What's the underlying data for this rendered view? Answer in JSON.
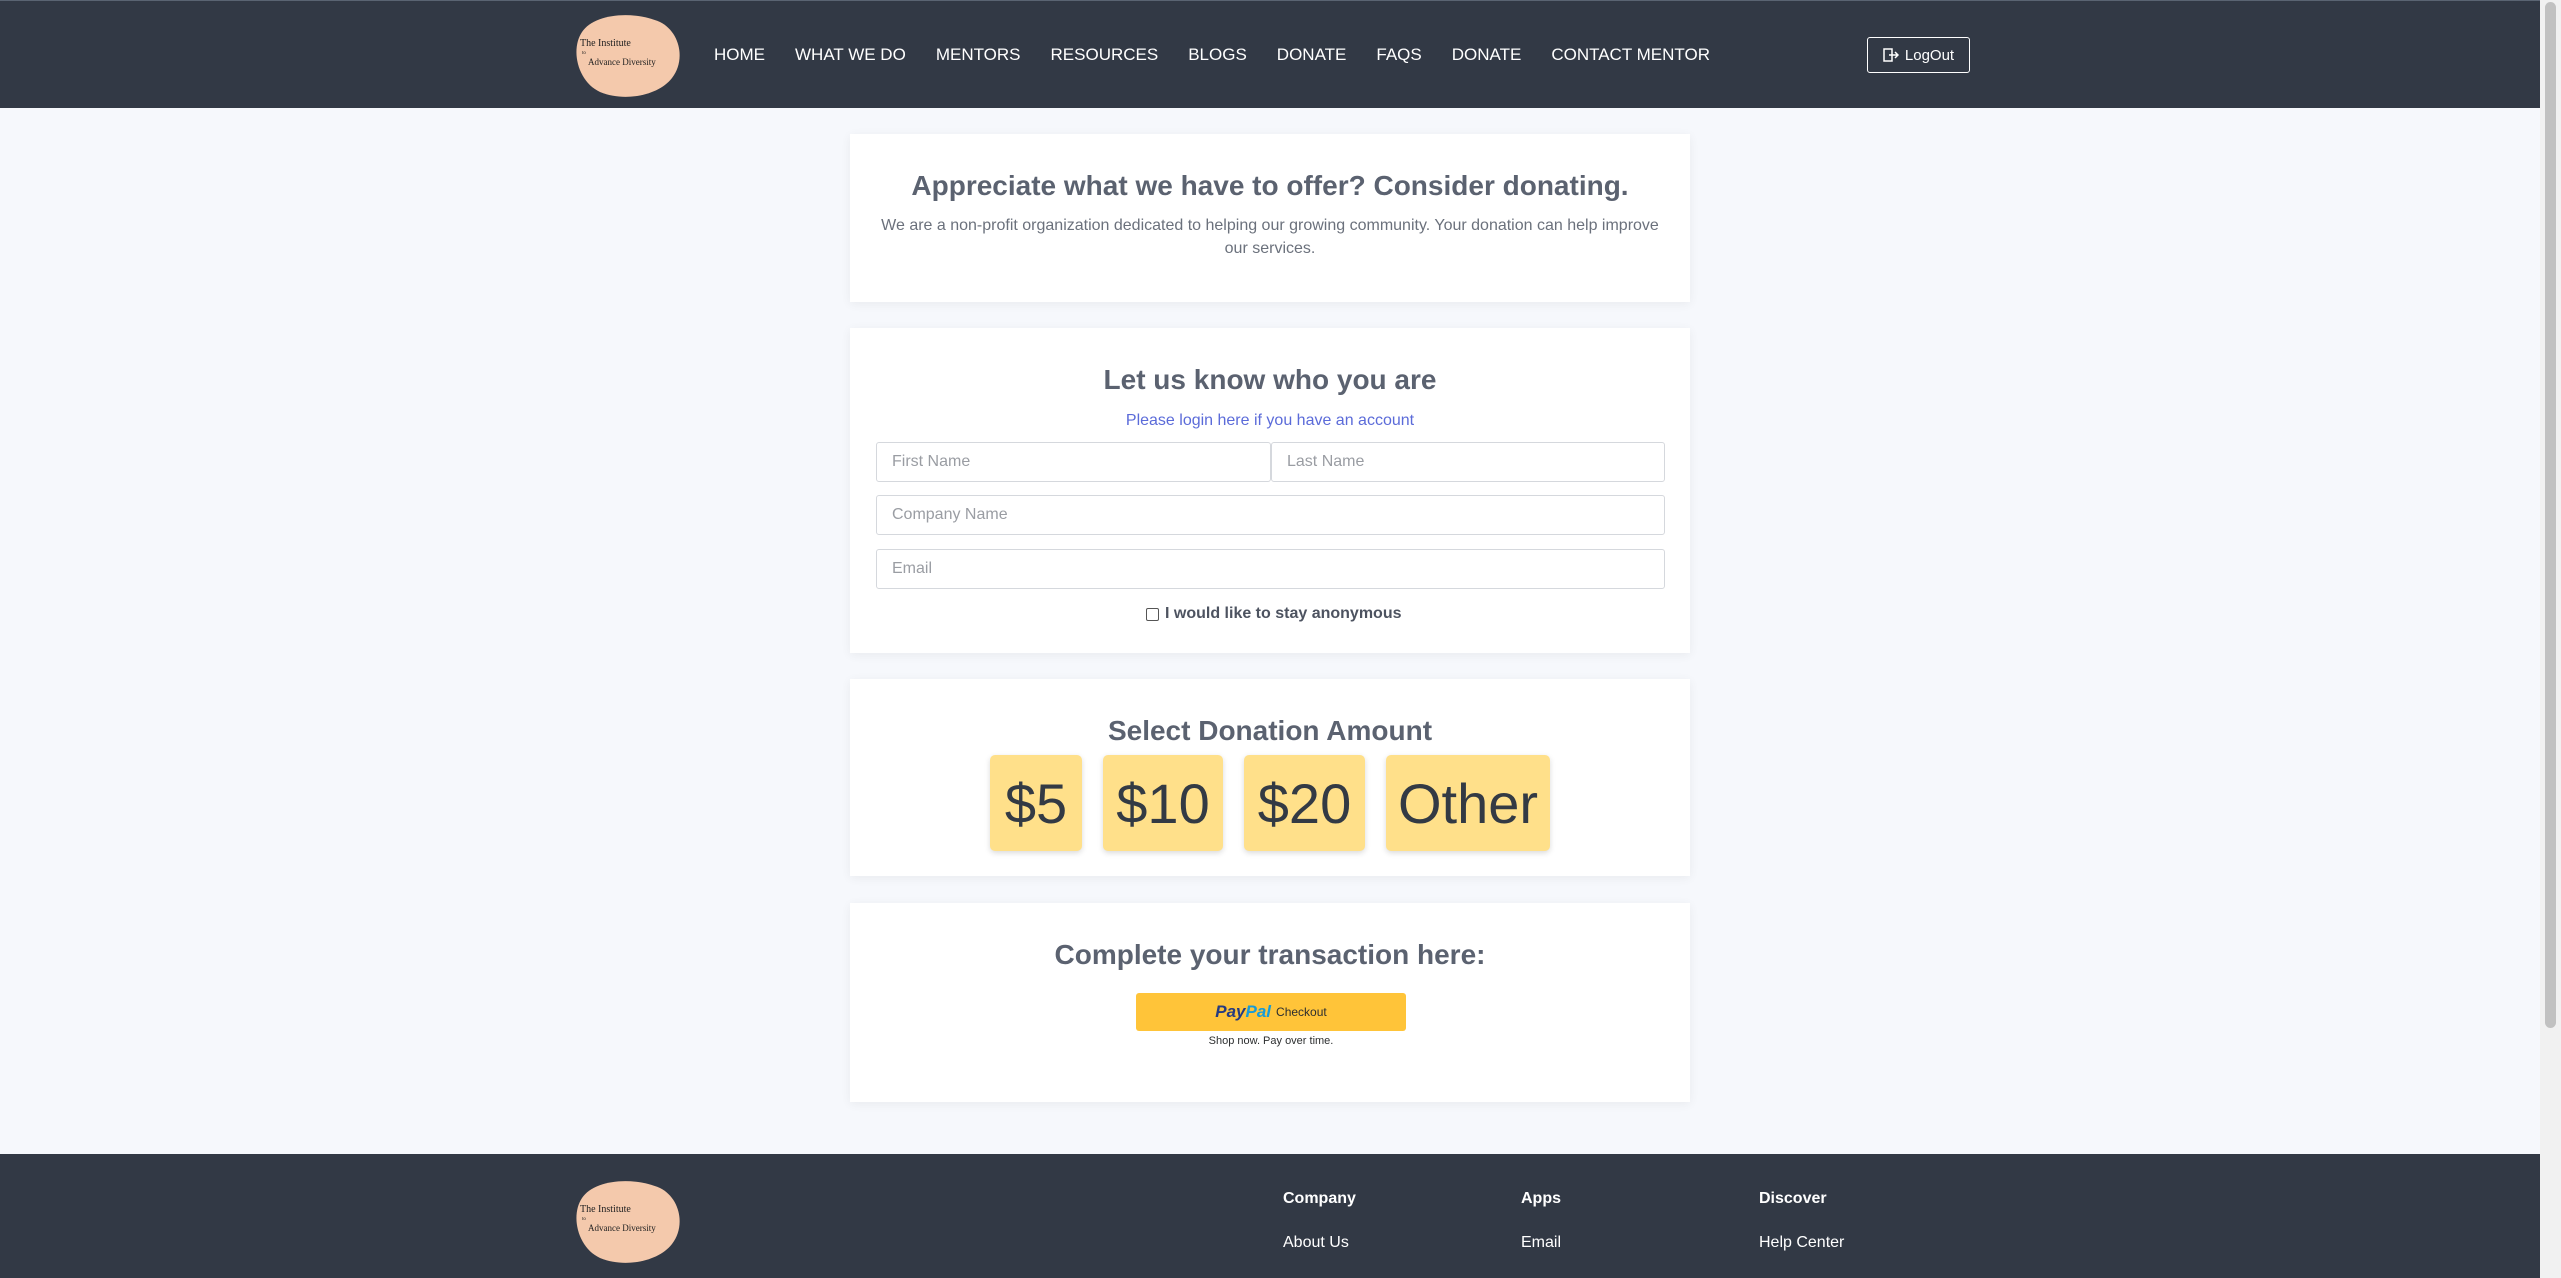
{
  "header": {
    "logo": {
      "line1": "The Institute",
      "line2": "to",
      "line3": "Advance Diversity"
    },
    "nav": [
      "HOME",
      "WHAT WE DO",
      "MENTORS",
      "RESOURCES",
      "BLOGS",
      "DONATE",
      "FAQS",
      "DONATE",
      "CONTACT MENTOR"
    ],
    "logout_label": "LogOut"
  },
  "intro": {
    "title": "Appreciate what we have to offer? Consider donating.",
    "text": "We are a non-profit organization dedicated to helping our growing community. Your donation can help improve our services."
  },
  "identity": {
    "title": "Let us know who you are",
    "login_link": "Please login here if you have an account",
    "first_name_placeholder": "First Name",
    "last_name_placeholder": "Last Name",
    "company_placeholder": "Company Name",
    "email_placeholder": "Email",
    "anonymous_label": "I would like to stay anonymous",
    "anonymous_checked": false
  },
  "donation": {
    "title": "Select Donation Amount",
    "amounts": [
      "$5",
      "$10",
      "$20",
      "Other"
    ]
  },
  "transaction": {
    "title": "Complete your transaction here:",
    "paypal_word1": "Pay",
    "paypal_word2": "Pal",
    "paypal_checkout": "Checkout",
    "paypal_tagline": "Shop now. Pay over time."
  },
  "footer": {
    "columns": [
      {
        "title": "Company",
        "link": "About Us"
      },
      {
        "title": "Apps",
        "link": "Email"
      },
      {
        "title": "Discover",
        "link": "Help Center"
      }
    ]
  },
  "colors": {
    "header_bg": "#323945",
    "amount_button": "#ffe08a",
    "paypal_button": "#ffc439",
    "link": "#5b6bd9"
  }
}
